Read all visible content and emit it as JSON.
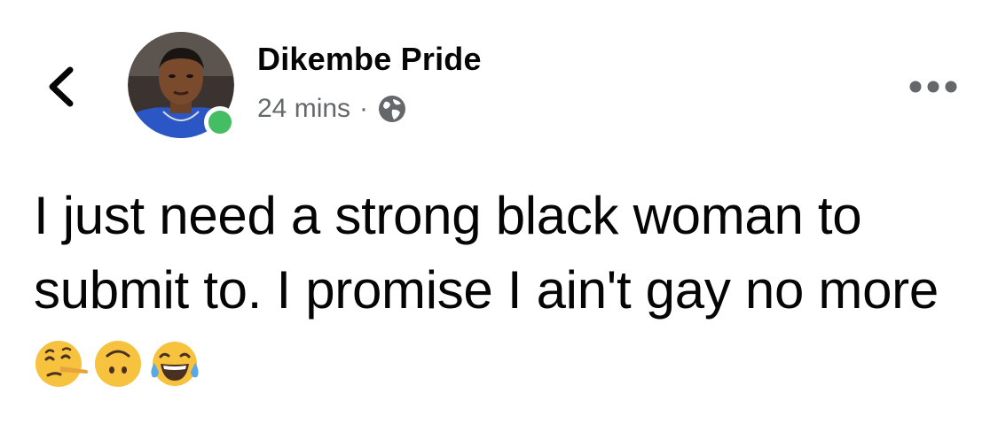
{
  "post": {
    "author_name": "Dikembe Pride",
    "timestamp": "24 mins",
    "separator": "·",
    "audience_icon": "globe-icon",
    "text_main": "I just need a strong black woman to submit to. I promise I ain't gay no more",
    "emojis": [
      "lying-face-emoji",
      "upside-down-face-emoji",
      "tears-of-joy-emoji"
    ],
    "online": true
  },
  "header": {
    "back_icon": "chevron-left-icon",
    "more_icon": "more-horizontal-icon"
  },
  "colors": {
    "text": "#050505",
    "secondary_text": "#65676b",
    "presence": "#45bd62",
    "background": "#ffffff"
  }
}
